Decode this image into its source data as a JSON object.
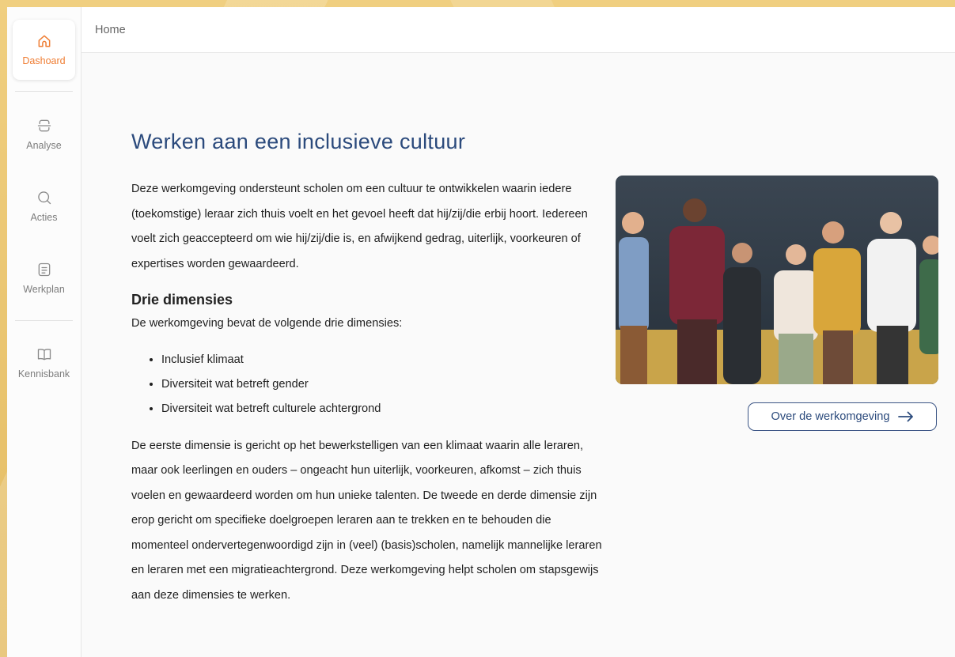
{
  "sidebar": {
    "items": [
      {
        "label": "Dashoard",
        "icon": "home-icon",
        "active": true
      },
      {
        "label": "Analyse",
        "icon": "scan-icon",
        "active": false
      },
      {
        "label": "Acties",
        "icon": "search-icon",
        "active": false
      },
      {
        "label": "Werkplan",
        "icon": "document-icon",
        "active": false
      },
      {
        "label": "Kennisbank",
        "icon": "book-icon",
        "active": false
      }
    ]
  },
  "header": {
    "breadcrumb": "Home"
  },
  "main": {
    "title": "Werken aan een inclusieve cultuur",
    "intro": "Deze werkomgeving ondersteunt scholen om een cultuur te ontwikkelen waarin iedere (toekomstige) leraar zich thuis voelt en het gevoel heeft dat hij/zij/die erbij hoort. Iedereen voelt zich geaccepteerd om wie hij/zij/die is, en afwijkend gedrag, uiterlijk, voorkeuren of expertises worden gewaardeerd.",
    "dimensions_heading": "Drie dimensies",
    "dimensions_intro": "De werkomgeving bevat de volgende drie dimensies:",
    "dimensions": [
      "Inclusief klimaat",
      "Diversiteit wat betreft gender",
      "Diversiteit wat betreft culturele achtergrond"
    ],
    "body": "De eerste dimensie is gericht op het bewerkstelligen van een klimaat waarin alle leraren, maar ook leerlingen en ouders – ongeacht hun uiterlijk, voorkeuren, afkomst – zich thuis voelen en gewaardeerd worden om hun unieke talenten. De tweede en derde dimensie zijn erop gericht om specifieke doelgroepen leraren aan te trekken en te behouden die momenteel ondervertegenwoordigd zijn in (veel) (basis)scholen, namelijk mannelijke leraren en leraren met een migratieachtergrond. Deze werkomgeving helpt scholen om stapsgewijs aan deze dimensies te werken.",
    "cta_label": "Over de werkomgeving",
    "cta_icon": "arrow-right-icon"
  },
  "colors": {
    "accent": "#ef7d33",
    "title": "#2b4a7c",
    "backdrop": "#e9c46f"
  }
}
